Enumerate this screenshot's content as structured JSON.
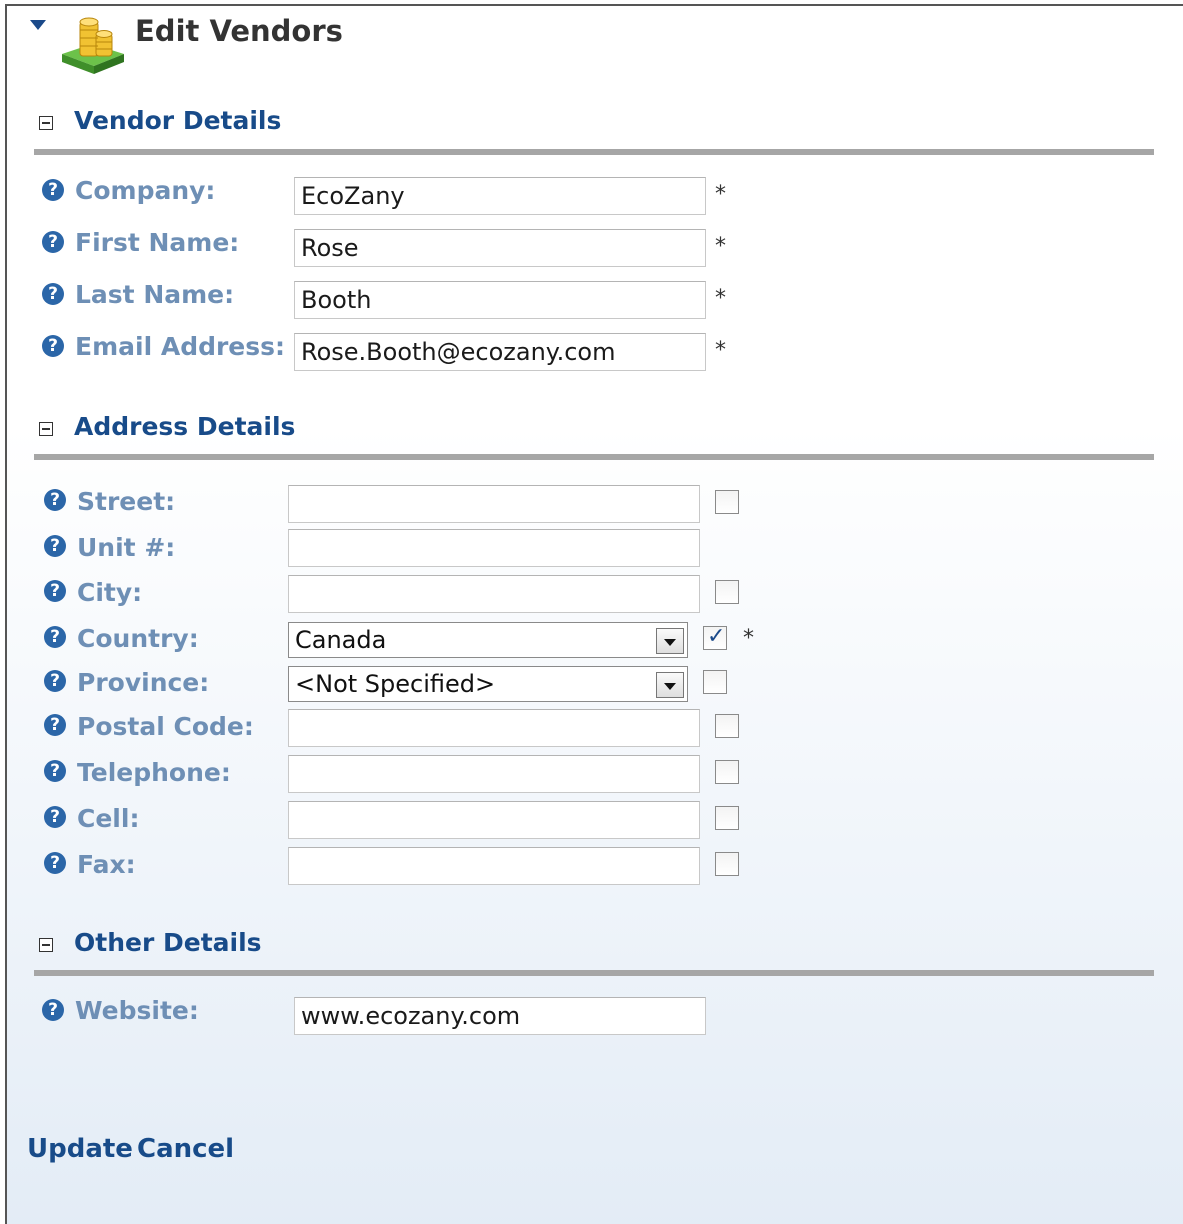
{
  "page": {
    "title": "Edit Vendors",
    "icon": "coins-stack-icon"
  },
  "sections": {
    "vendor": {
      "heading": "Vendor Details",
      "fields": [
        {
          "label": "Company:",
          "value": "EcoZany",
          "required": "*"
        },
        {
          "label": "First Name:",
          "value": "Rose",
          "required": "*"
        },
        {
          "label": "Last Name:",
          "value": "Booth",
          "required": "*"
        },
        {
          "label": "Email Address:",
          "value": "Rose.Booth@ecozany.com",
          "required": "*"
        }
      ]
    },
    "address": {
      "heading": "Address Details",
      "street": {
        "label": "Street:",
        "value": "",
        "checked": false
      },
      "unit": {
        "label": "Unit #:",
        "value": ""
      },
      "city": {
        "label": "City:",
        "value": "",
        "checked": false
      },
      "country": {
        "label": "Country:",
        "selected": "Canada",
        "checked": true,
        "required": "*"
      },
      "province": {
        "label": "Province:",
        "selected": "<Not Specified>",
        "checked": false
      },
      "postal": {
        "label": "Postal Code:",
        "value": "",
        "checked": false
      },
      "telephone": {
        "label": "Telephone:",
        "value": "",
        "checked": false
      },
      "cell": {
        "label": "Cell:",
        "value": "",
        "checked": false
      },
      "fax": {
        "label": "Fax:",
        "value": "",
        "checked": false
      }
    },
    "other": {
      "heading": "Other Details",
      "website": {
        "label": "Website:",
        "value": "www.ecozany.com"
      }
    }
  },
  "actions": {
    "update": "Update",
    "cancel": "Cancel"
  },
  "colors": {
    "heading": "#184b89",
    "label": "#6e8fb5",
    "help_icon": "#2b66a8",
    "rule": "#a6a6a6"
  },
  "help_icon_glyph": "?"
}
